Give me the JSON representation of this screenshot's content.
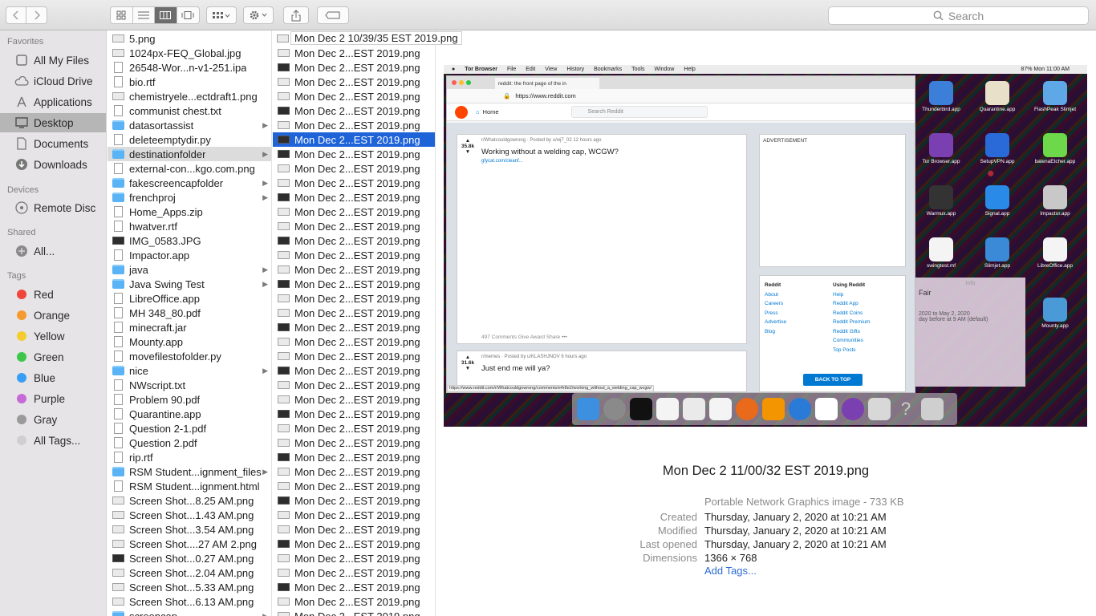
{
  "toolbar": {
    "search_placeholder": "Search"
  },
  "sidebar": {
    "favorites_header": "Favorites",
    "favorites": [
      "All My Files",
      "iCloud Drive",
      "Applications",
      "Desktop",
      "Documents",
      "Downloads"
    ],
    "devices_header": "Devices",
    "devices": [
      "Remote Disc"
    ],
    "shared_header": "Shared",
    "shared": [
      "All..."
    ],
    "tags_header": "Tags",
    "tags": [
      {
        "label": "Red",
        "color": "#f0453a"
      },
      {
        "label": "Orange",
        "color": "#f59a2f"
      },
      {
        "label": "Yellow",
        "color": "#f5cc2f"
      },
      {
        "label": "Green",
        "color": "#3cc64a"
      },
      {
        "label": "Blue",
        "color": "#3a9ef5"
      },
      {
        "label": "Purple",
        "color": "#c66ad8"
      },
      {
        "label": "Gray",
        "color": "#9a9a9a"
      },
      {
        "label": "All Tags...",
        "color": "#cfcfcf"
      }
    ]
  },
  "column1": [
    {
      "name": "5.png",
      "icon": "thumb"
    },
    {
      "name": "1024px-FEQ_Global.jpg",
      "icon": "thumb"
    },
    {
      "name": "26548-Wor...n-v1-251.ipa",
      "icon": "doc"
    },
    {
      "name": "bio.rtf",
      "icon": "doc"
    },
    {
      "name": "chemistryele...ectdraft1.png",
      "icon": "thumb"
    },
    {
      "name": "communist chest.txt",
      "icon": "doc"
    },
    {
      "name": "datasortassist",
      "icon": "folder",
      "arrow": true
    },
    {
      "name": "deleteemptydir.py",
      "icon": "doc"
    },
    {
      "name": "destinationfolder",
      "icon": "folder",
      "arrow": true,
      "selected": true
    },
    {
      "name": "external-con...kgo.com.png",
      "icon": "doc"
    },
    {
      "name": "fakescreencapfolder",
      "icon": "folder",
      "arrow": true
    },
    {
      "name": "frenchproj",
      "icon": "folder",
      "arrow": true
    },
    {
      "name": "Home_Apps.zip",
      "icon": "doc"
    },
    {
      "name": "hwatver.rtf",
      "icon": "doc"
    },
    {
      "name": "IMG_0583.JPG",
      "icon": "thumbdark"
    },
    {
      "name": "Impactor.app",
      "icon": "doc"
    },
    {
      "name": "java",
      "icon": "folder",
      "arrow": true
    },
    {
      "name": "Java Swing Test",
      "icon": "folder",
      "arrow": true
    },
    {
      "name": "LibreOffice.app",
      "icon": "doc"
    },
    {
      "name": "MH 348_80.pdf",
      "icon": "doc"
    },
    {
      "name": "minecraft.jar",
      "icon": "doc"
    },
    {
      "name": "Mounty.app",
      "icon": "doc"
    },
    {
      "name": "movefilestofolder.py",
      "icon": "doc"
    },
    {
      "name": "nice",
      "icon": "folder",
      "arrow": true
    },
    {
      "name": "NWscript.txt",
      "icon": "doc"
    },
    {
      "name": "Problem 90.pdf",
      "icon": "doc"
    },
    {
      "name": "Quarantine.app",
      "icon": "doc"
    },
    {
      "name": "Question 2-1.pdf",
      "icon": "doc"
    },
    {
      "name": "Question 2.pdf",
      "icon": "doc"
    },
    {
      "name": "rip.rtf",
      "icon": "doc"
    },
    {
      "name": "RSM Student...ignment_files",
      "icon": "folder",
      "arrow": true
    },
    {
      "name": "RSM Student...ignment.html",
      "icon": "doc"
    },
    {
      "name": "Screen Shot...8.25 AM.png",
      "icon": "thumb"
    },
    {
      "name": "Screen Shot...1.43 AM.png",
      "icon": "thumb"
    },
    {
      "name": "Screen Shot...3.54 AM.png",
      "icon": "thumb"
    },
    {
      "name": "Screen Shot....27 AM 2.png",
      "icon": "thumb"
    },
    {
      "name": "Screen Shot...0.27 AM.png",
      "icon": "thumbdark"
    },
    {
      "name": "Screen Shot...2.04 AM.png",
      "icon": "thumb"
    },
    {
      "name": "Screen Shot...5.33 AM.png",
      "icon": "thumb"
    },
    {
      "name": "Screen Shot...6.13 AM.png",
      "icon": "thumb"
    },
    {
      "name": "screencap",
      "icon": "folder",
      "arrow": true
    }
  ],
  "column2": {
    "tooltip": "Mon Dec  2 10/39/35 EST 2019.png",
    "first": "Mon Dec  2 10/39/35 EST 2019.png",
    "item": "Mon Dec  2...EST 2019.png",
    "count": 41,
    "selected_index": 7
  },
  "preview": {
    "filename": "Mon Dec  2 11/00/32 EST 2019.png",
    "kind": "Portable Network Graphics image - 733 KB",
    "meta": [
      {
        "key": "Created",
        "value": "Thursday, January 2, 2020 at 10:21 AM"
      },
      {
        "key": "Modified",
        "value": "Thursday, January 2, 2020 at 10:21 AM"
      },
      {
        "key": "Last opened",
        "value": "Thursday, January 2, 2020 at 10:21 AM"
      },
      {
        "key": "Dimensions",
        "value": "1366 × 768"
      }
    ],
    "add_tags": "Add Tags...",
    "shot": {
      "menubar": [
        "Tor Browser",
        "File",
        "Edit",
        "View",
        "History",
        "Bookmarks",
        "Tools",
        "Window",
        "Help"
      ],
      "menubar_right": "87%  Mon 11:00 AM",
      "tab_title": "reddit: the front page of the in",
      "url": "https://www.reddit.com",
      "home": "Home",
      "search": "Search Reddit",
      "post1_sub": "r/Whatcouldgowrong · Posted by u/wj7_02 12 hours ago",
      "post1_title": "Working without a welding cap, WCGW?",
      "post1_votes": "35.8k",
      "post1_link": "gfycat.com/cleanf...",
      "post1_actions": "497 Comments   Give Award   Share   •••",
      "post2_sub": "r/memes · Posted by u/KLASHJNOV 6 hours ago",
      "post2_title": "Just end me will ya?",
      "post2_votes": "31.6k",
      "ad": "ADVERTISEMENT",
      "links_left": [
        "Reddit",
        "About",
        "Careers",
        "Press",
        "Advertise",
        "Blog"
      ],
      "links_right": [
        "Using Reddit",
        "Help",
        "Reddit App",
        "Reddit Coins",
        "Reddit Premium",
        "Reddit Gifts",
        "Communities",
        "Top Posts"
      ],
      "back_to_top": "BACK TO TOP",
      "status_url": "https://www.reddit.com/r/Whatcouldgowrong/comments/e4r8e2/working_without_a_welding_cap_wcgw/",
      "desktop_apps": [
        {
          "label": "Thunderbird.app",
          "color": "#3b7fd8"
        },
        {
          "label": "Quarantine.app",
          "color": "#e8e0c8"
        },
        {
          "label": "FlashPeak Slimjet",
          "color": "#5fa8e8"
        },
        {
          "label": "Tor Browser.app",
          "color": "#7a3fb0"
        },
        {
          "label": "SetupVPN.app",
          "color": "#2a6ad8"
        },
        {
          "label": "balenaEtcher.app",
          "color": "#6cd84a"
        },
        {
          "label": "Warmux.app",
          "color": "#333333"
        },
        {
          "label": "Signal.app",
          "color": "#2a8ae8"
        },
        {
          "label": "Impactor.app",
          "color": "#c8c8c8"
        },
        {
          "label": "swingtest.mf",
          "color": "#f4f4f4"
        },
        {
          "label": "Slimjet.app",
          "color": "#3a8ad8"
        },
        {
          "label": "LibreOffice.app",
          "color": "#f4f4f4"
        },
        {
          "label": "Mounty.app",
          "color": "#4a9ad8"
        }
      ],
      "reminder": {
        "title": "Fair",
        "line1": "2020 to May 2, 2020",
        "line2": "day before at 9 AM (default)"
      }
    }
  }
}
